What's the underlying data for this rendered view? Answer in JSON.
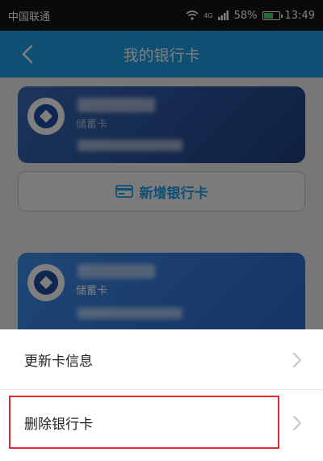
{
  "status_bar": {
    "carrier": "中国联通",
    "signal_label": "4G",
    "battery": "58%",
    "time": "13:49"
  },
  "nav": {
    "title": "我的银行卡",
    "back_icon": "chevron-left-icon"
  },
  "cards": [
    {
      "type_label": "储蓄卡"
    },
    {
      "type_label": "储蓄卡"
    }
  ],
  "add_card": {
    "label": "新增银行卡",
    "icon": "card-icon"
  },
  "action_sheet": {
    "items": [
      {
        "label": "更新卡信息"
      },
      {
        "label": "删除银行卡"
      }
    ]
  },
  "colors": {
    "accent": "#1d9ee6",
    "highlight": "#e0282e"
  }
}
